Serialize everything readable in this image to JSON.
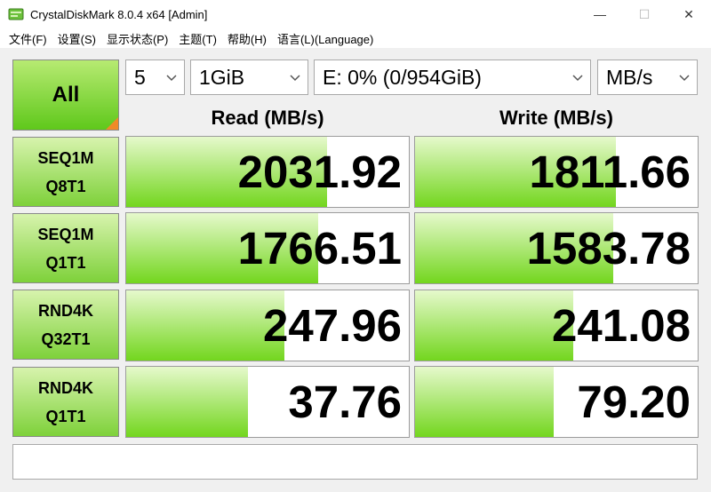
{
  "window": {
    "title": "CrystalDiskMark 8.0.4 x64 [Admin]",
    "minimize_glyph": "—",
    "maximize_glyph": "☐",
    "close_glyph": "✕",
    "icon": "crystaldiskmark-app-icon"
  },
  "menu": [
    {
      "label": "文件(F)"
    },
    {
      "label": "设置(S)"
    },
    {
      "label": "显示状态(P)"
    },
    {
      "label": "主题(T)"
    },
    {
      "label": "帮助(H)"
    },
    {
      "label": "语言(L)(Language)"
    }
  ],
  "controls": {
    "all_label": "All",
    "count": "5",
    "size": "1GiB",
    "drive": "E: 0% (0/954GiB)",
    "unit": "MB/s"
  },
  "headers": {
    "read": "Read (MB/s)",
    "write": "Write (MB/s)"
  },
  "tests": [
    {
      "line1": "SEQ1M",
      "line2": "Q8T1",
      "read": "2031.92",
      "write": "1811.66",
      "read_fill": 0.71,
      "write_fill": 0.71
    },
    {
      "line1": "SEQ1M",
      "line2": "Q1T1",
      "read": "1766.51",
      "write": "1583.78",
      "read_fill": 0.68,
      "write_fill": 0.7
    },
    {
      "line1": "RND4K",
      "line2": "Q32T1",
      "read": "247.96",
      "write": "241.08",
      "read_fill": 0.56,
      "write_fill": 0.56
    },
    {
      "line1": "RND4K",
      "line2": "Q1T1",
      "read": "37.76",
      "write": "79.20",
      "read_fill": 0.43,
      "write_fill": 0.49
    }
  ],
  "comment": "",
  "colors": {
    "accent_green": "#73d61e",
    "corner_orange": "#f08a28"
  }
}
